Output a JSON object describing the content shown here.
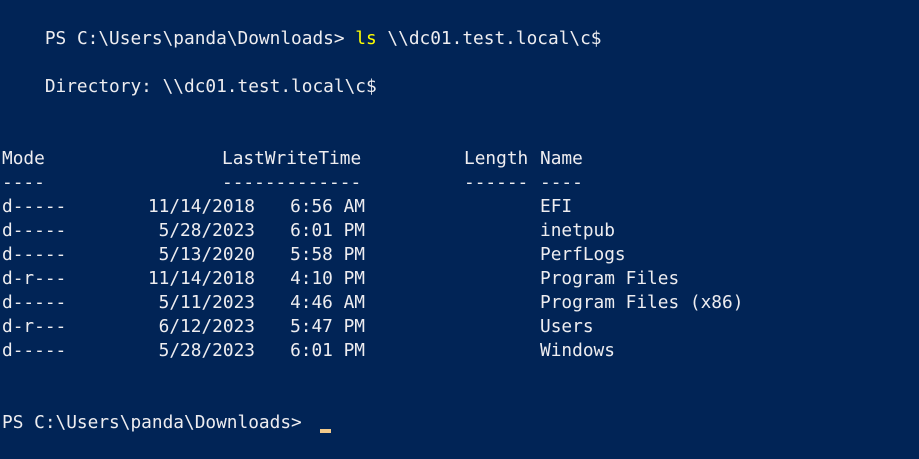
{
  "terminal": {
    "prompt": "PS C:\\Users\\panda\\Downloads> ",
    "command": "ls",
    "argument": " \\\\dc01.test.local\\c$",
    "directory_label": "    Directory: \\\\dc01.test.local\\c$",
    "headers": {
      "mode": "Mode",
      "last_write_time": "LastWriteTime",
      "length": "Length",
      "name": "Name"
    },
    "separators": {
      "mode": "----",
      "last_write_time": "-------------",
      "length": "------",
      "name": "----"
    },
    "rows": [
      {
        "mode": "d-----",
        "date": "11/14/2018",
        "time": "6:56 AM",
        "length": "",
        "name": "EFI"
      },
      {
        "mode": "d-----",
        "date": "5/28/2023",
        "time": "6:01 PM",
        "length": "",
        "name": "inetpub"
      },
      {
        "mode": "d-----",
        "date": "5/13/2020",
        "time": "5:58 PM",
        "length": "",
        "name": "PerfLogs"
      },
      {
        "mode": "d-r---",
        "date": "11/14/2018",
        "time": "4:10 PM",
        "length": "",
        "name": "Program Files"
      },
      {
        "mode": "d-----",
        "date": "5/11/2023",
        "time": "4:46 AM",
        "length": "",
        "name": "Program Files (x86)"
      },
      {
        "mode": "d-r---",
        "date": "6/12/2023",
        "time": "5:47 PM",
        "length": "",
        "name": "Users"
      },
      {
        "mode": "d-----",
        "date": "5/28/2023",
        "time": "6:01 PM",
        "length": "",
        "name": "Windows"
      }
    ],
    "final_prompt": "PS C:\\Users\\panda\\Downloads> "
  },
  "colors": {
    "background": "#012456",
    "foreground": "#eeedf0",
    "command": "#ffff00",
    "cursor": "#f2c98a"
  }
}
